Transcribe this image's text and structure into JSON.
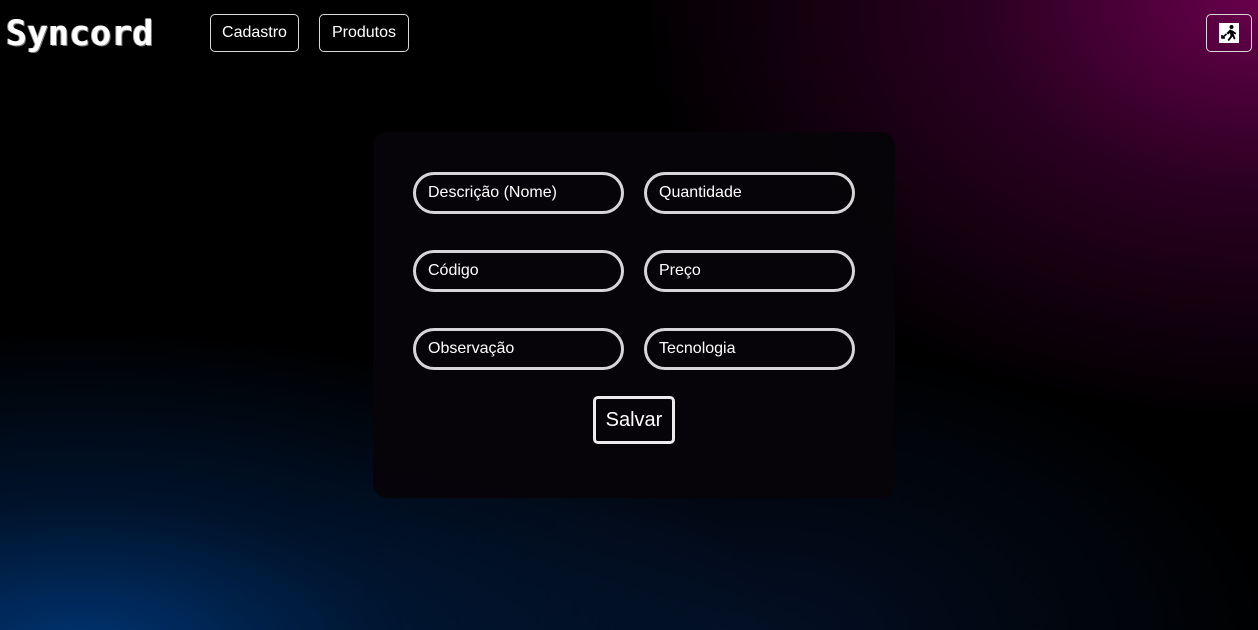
{
  "header": {
    "logo_text": "Syncord",
    "nav": {
      "cadastro_label": "Cadastro",
      "produtos_label": "Produtos"
    },
    "exit_icon": "exit-door-icon"
  },
  "form": {
    "fields": {
      "descricao": {
        "placeholder": "Descrição (Nome)",
        "value": ""
      },
      "quantidade": {
        "placeholder": "Quantidade",
        "value": ""
      },
      "codigo": {
        "placeholder": "Código",
        "value": ""
      },
      "preco": {
        "placeholder": "Preço",
        "value": ""
      },
      "observacao": {
        "placeholder": "Observação",
        "value": ""
      },
      "tecnologia": {
        "placeholder": "Tecnologia",
        "value": ""
      }
    },
    "save_label": "Salvar"
  },
  "colors": {
    "background": "#000000",
    "accent_magenta": "#6e0050",
    "accent_blue": "#003778",
    "panel": "#060409",
    "border": "#d6d6da"
  }
}
